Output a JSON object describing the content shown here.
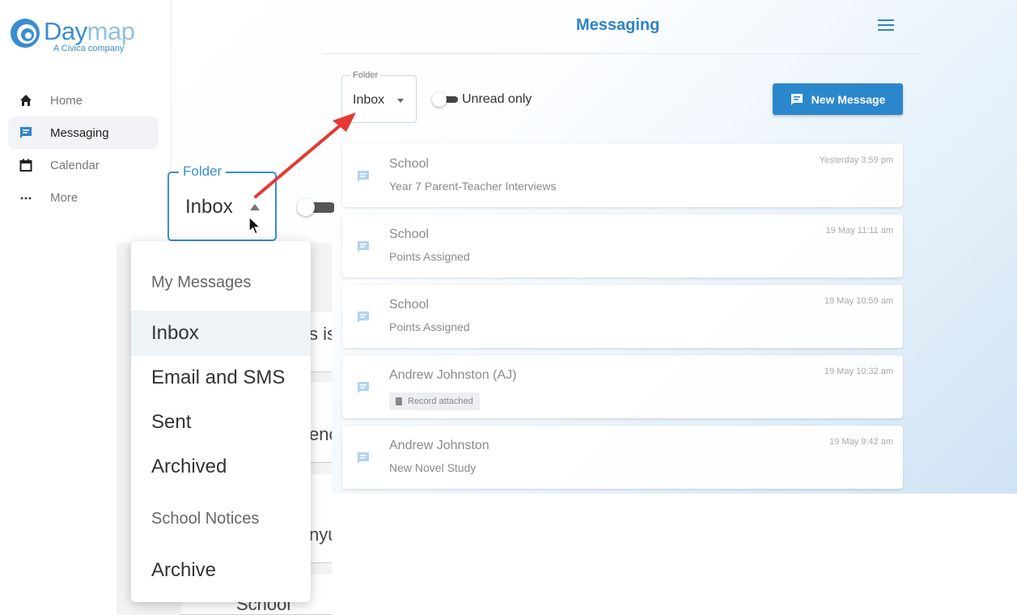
{
  "logo": {
    "word_dark": "Day",
    "word_light": "map",
    "subtitle": "A Civica company"
  },
  "sidebar": {
    "items": [
      {
        "label": "Home",
        "icon": "home-icon"
      },
      {
        "label": "Messaging",
        "icon": "message-icon",
        "active": true
      },
      {
        "label": "Calendar",
        "icon": "calendar-icon"
      },
      {
        "label": "More",
        "icon": "more-icon"
      }
    ]
  },
  "header": {
    "title": "Messaging",
    "menu_icon": "hamburger-icon"
  },
  "toolbar": {
    "folder_label": "Folder",
    "folder_value": "Inbox",
    "unread_label": "Unread only",
    "new_message_label": "New Message"
  },
  "messages": [
    {
      "sender": "School",
      "subject": "Year 7 Parent-Teacher Interviews",
      "time": "Yesterday 3:59 pm"
    },
    {
      "sender": "School",
      "subject": "Points Assigned",
      "time": "19 May 11:11 am"
    },
    {
      "sender": "School",
      "subject": "Points Assigned",
      "time": "19 May 10:59 am"
    },
    {
      "sender": "Andrew Johnston (AJ)",
      "attachment": "Record attached",
      "time": "19 May 10:32 am"
    },
    {
      "sender": "Andrew Johnston",
      "subject": "New Novel Study",
      "time": "19 May 9:42 am"
    }
  ],
  "zoom": {
    "folder_label": "Folder",
    "folder_value": "Inbox",
    "background_fragments": [
      "s is",
      "enc",
      "nyu",
      "School"
    ]
  },
  "dropdown": {
    "sections": [
      {
        "header": "My Messages",
        "items": [
          "Inbox",
          "Email and SMS",
          "Sent",
          "Archived"
        ]
      },
      {
        "header": "School Notices",
        "items": [
          "Archive"
        ]
      }
    ],
    "selected": "Inbox"
  },
  "colors": {
    "accent": "#2e83c9",
    "button": "#2b87cc",
    "annotation_arrow": "#e53935"
  }
}
